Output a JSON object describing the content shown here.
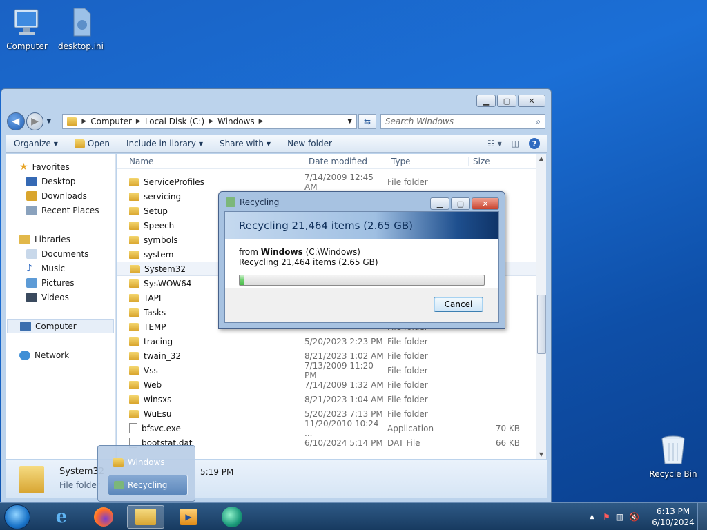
{
  "desktop": {
    "icons": [
      {
        "label": "Computer"
      },
      {
        "label": "desktop.ini"
      },
      {
        "label": "Recycle Bin"
      }
    ]
  },
  "explorer": {
    "breadcrumb": [
      "Computer",
      "Local Disk (C:)",
      "Windows"
    ],
    "search_placeholder": "Search Windows",
    "toolbar": {
      "organize": "Organize",
      "open": "Open",
      "include": "Include in library",
      "share": "Share with",
      "new_folder": "New folder"
    },
    "nav": {
      "favorites": "Favorites",
      "desktop": "Desktop",
      "downloads": "Downloads",
      "recent": "Recent Places",
      "libraries": "Libraries",
      "documents": "Documents",
      "music": "Music",
      "pictures": "Pictures",
      "videos": "Videos",
      "computer": "Computer",
      "network": "Network"
    },
    "columns": {
      "name": "Name",
      "date": "Date modified",
      "type": "Type",
      "size": "Size"
    },
    "rows": [
      {
        "name": "ServiceProfiles",
        "date": "7/14/2009 12:45 AM",
        "type": "File folder",
        "size": ""
      },
      {
        "name": "servicing",
        "date": "",
        "type": "",
        "size": ""
      },
      {
        "name": "Setup",
        "date": "",
        "type": "",
        "size": ""
      },
      {
        "name": "Speech",
        "date": "",
        "type": "",
        "size": ""
      },
      {
        "name": "symbols",
        "date": "",
        "type": "",
        "size": ""
      },
      {
        "name": "system",
        "date": "",
        "type": "",
        "size": ""
      },
      {
        "name": "System32",
        "date": "",
        "type": "",
        "size": ""
      },
      {
        "name": "SysWOW64",
        "date": "",
        "type": "",
        "size": ""
      },
      {
        "name": "TAPI",
        "date": "",
        "type": "",
        "size": ""
      },
      {
        "name": "Tasks",
        "date": "",
        "type": "",
        "size": ""
      },
      {
        "name": "TEMP",
        "date": "",
        "type": "File folder",
        "size": ""
      },
      {
        "name": "tracing",
        "date": "5/20/2023 2:23 PM",
        "type": "File folder",
        "size": ""
      },
      {
        "name": "twain_32",
        "date": "8/21/2023 1:02 AM",
        "type": "File folder",
        "size": ""
      },
      {
        "name": "Vss",
        "date": "7/13/2009 11:20 PM",
        "type": "File folder",
        "size": ""
      },
      {
        "name": "Web",
        "date": "7/14/2009 1:32 AM",
        "type": "File folder",
        "size": ""
      },
      {
        "name": "winsxs",
        "date": "8/21/2023 1:04 AM",
        "type": "File folder",
        "size": ""
      },
      {
        "name": "WuEsu",
        "date": "5/20/2023 7:13 PM",
        "type": "File folder",
        "size": ""
      },
      {
        "name": "bfsvc.exe",
        "date": "11/20/2010 10:24 ...",
        "type": "Application",
        "size": "70 KB"
      },
      {
        "name": "bootstat.dat",
        "date": "6/10/2024 5:14 PM",
        "type": "DAT File",
        "size": "66 KB"
      }
    ],
    "details": {
      "name": "System32",
      "type": "File folder",
      "date_fragment": "5:19 PM"
    }
  },
  "dialog": {
    "title": "Recycling",
    "heading": "Recycling 21,464 items (2.65 GB)",
    "from_prefix": "from",
    "from_name": "Windows",
    "from_path": "(C:\\Windows)",
    "status": "Recycling 21,464 items (2.65 GB)",
    "progress": 0.02,
    "cancel": "Cancel"
  },
  "popup": {
    "items": [
      "Windows",
      "Recycling"
    ]
  },
  "taskbar": {
    "time": "6:13 PM",
    "date": "6/10/2024"
  }
}
